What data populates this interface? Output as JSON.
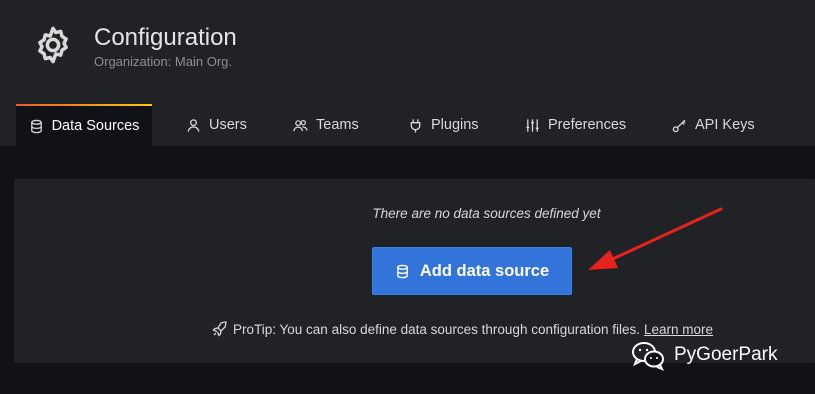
{
  "header": {
    "title": "Configuration",
    "subtitle": "Organization: Main Org.",
    "icon": "gear-icon"
  },
  "tabs": [
    {
      "label": "Data Sources",
      "icon": "database-icon",
      "active": true
    },
    {
      "label": "Users",
      "icon": "user-icon",
      "active": false
    },
    {
      "label": "Teams",
      "icon": "users-icon",
      "active": false
    },
    {
      "label": "Plugins",
      "icon": "plug-icon",
      "active": false
    },
    {
      "label": "Preferences",
      "icon": "sliders-icon",
      "active": false
    },
    {
      "label": "API Keys",
      "icon": "key-icon",
      "active": false
    }
  ],
  "empty_state": {
    "message": "There are no data sources defined yet",
    "button_label": "Add data source",
    "button_icon": "database-icon",
    "protip_text": "ProTip: You can also define data sources through configuration files.",
    "protip_icon": "rocket-icon",
    "learn_more": "Learn more"
  },
  "watermark": {
    "text": "PyGoerPark",
    "icon": "wechat-icon"
  },
  "colors": {
    "background": "#111217",
    "panel": "#202226",
    "primary_button": "#3274d9",
    "tab_accent_start": "#f05a28",
    "tab_accent_end": "#fbca0a",
    "annotation_arrow": "#e8231e"
  }
}
